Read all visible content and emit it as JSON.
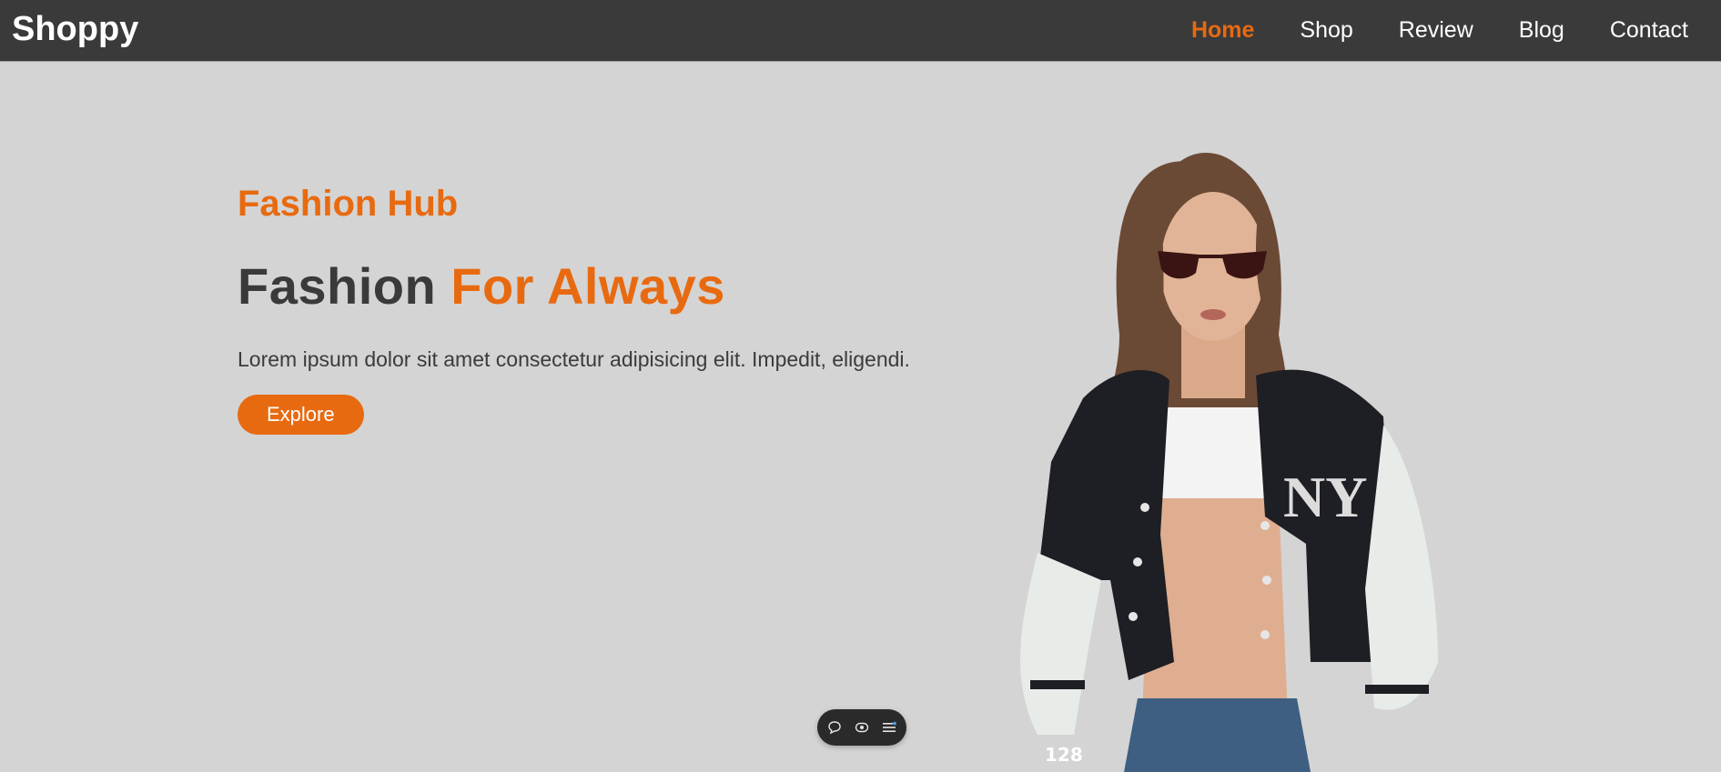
{
  "nav": {
    "brand": "Shoppy",
    "links": [
      {
        "label": "Home",
        "active": true
      },
      {
        "label": "Shop",
        "active": false
      },
      {
        "label": "Review",
        "active": false
      },
      {
        "label": "Blog",
        "active": false
      },
      {
        "label": "Contact",
        "active": false
      }
    ]
  },
  "hero": {
    "eyebrow": "Fashion Hub",
    "headline_part1": "Fashion",
    "headline_accent": "For Always",
    "lede": "Lorem ipsum dolor sit amet consectetur adipisicing elit. Impedit, eligendi.",
    "cta_label": "Explore",
    "figure_caption": "128"
  },
  "toolbar": {
    "icons": [
      "comment-icon",
      "eye-icon",
      "menu-icon"
    ]
  },
  "colors": {
    "accent": "#e86a10",
    "nav_bg": "#3a3a3a",
    "page_bg": "#d4d4d4",
    "text_dark": "#3a3a3a"
  }
}
